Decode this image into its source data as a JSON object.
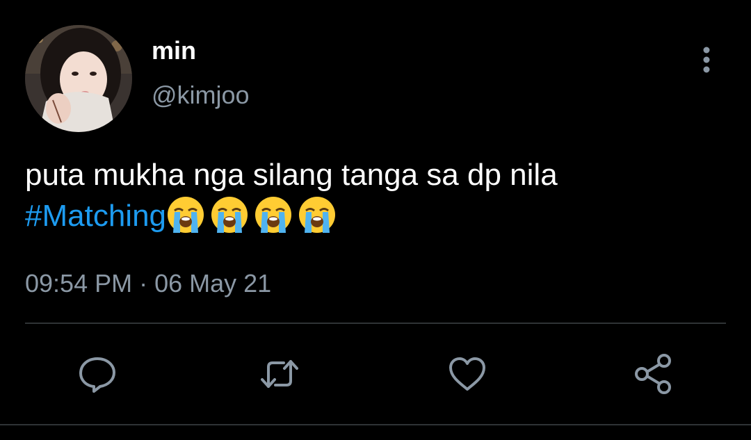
{
  "tweet": {
    "author": {
      "display_name": "min",
      "handle": "@kimjoo"
    },
    "text_line_1": "puta mukha nga silang tanga sa dp nila",
    "hashtag": "#Matching",
    "emojis": [
      "loudly-crying-face",
      "loudly-crying-face",
      "loudly-crying-face",
      "loudly-crying-face"
    ],
    "timestamp": "09:54 PM · 06 May 21"
  },
  "actions": [
    {
      "name": "reply",
      "icon": "speech-bubble-icon"
    },
    {
      "name": "retweet",
      "icon": "retweet-arrows-icon"
    },
    {
      "name": "like",
      "icon": "heart-icon"
    },
    {
      "name": "share",
      "icon": "share-nodes-icon"
    }
  ],
  "colors": {
    "background": "#000000",
    "primary_text": "#ffffff",
    "secondary_text": "#8b98a5",
    "hashtag": "#1d9bf0",
    "divider": "#2f3336"
  }
}
